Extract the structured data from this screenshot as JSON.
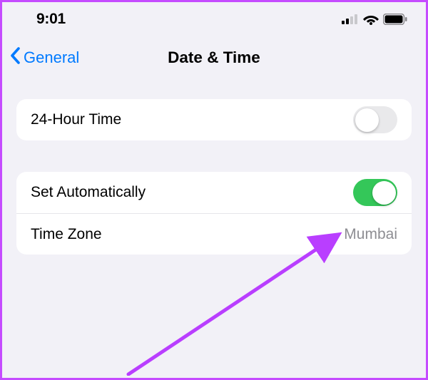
{
  "status": {
    "time": "9:01"
  },
  "nav": {
    "back_label": "General",
    "title": "Date & Time"
  },
  "group1": {
    "row0": {
      "label": "24-Hour Time",
      "on": false
    }
  },
  "group2": {
    "row0": {
      "label": "Set Automatically",
      "on": true
    },
    "row1": {
      "label": "Time Zone",
      "value": "Mumbai"
    }
  }
}
